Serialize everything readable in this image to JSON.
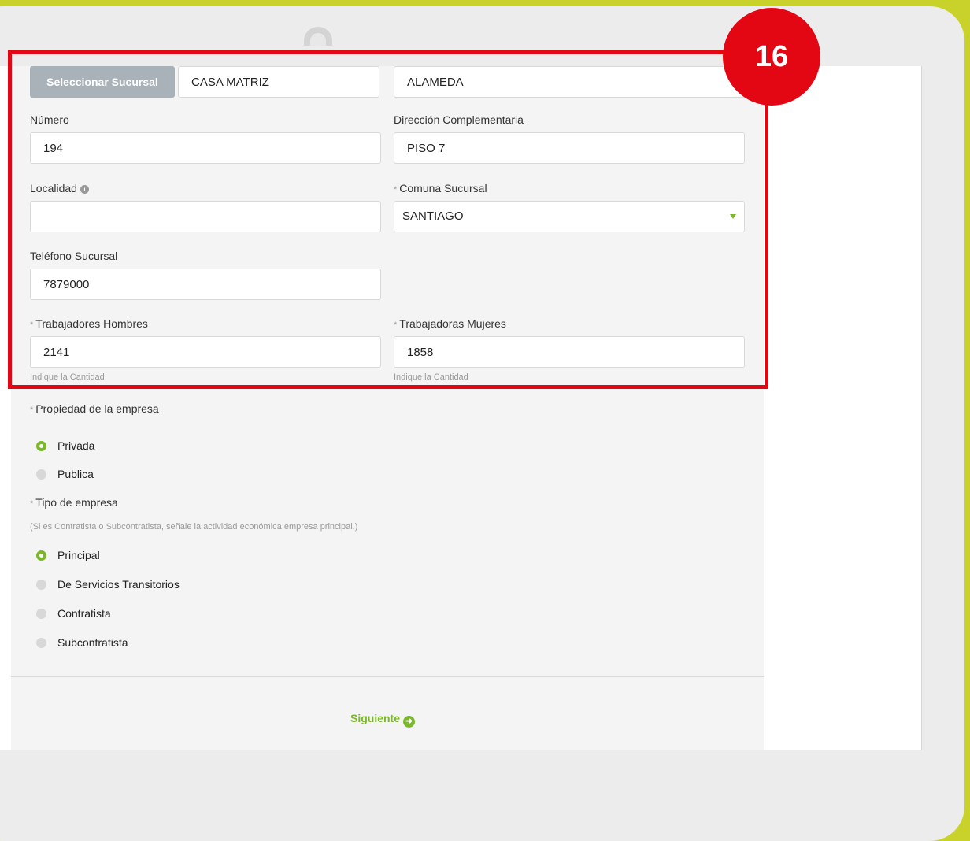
{
  "form": {
    "select_branch_button": "Seleccionar Sucursal",
    "branch_name": "CASA MATRIZ",
    "street": "ALAMEDA",
    "numero": {
      "label": "Número",
      "value": "194"
    },
    "direccion_complementaria": {
      "label": "Dirección Complementaria",
      "value": "PISO 7"
    },
    "localidad": {
      "label": "Localidad",
      "value": ""
    },
    "comuna": {
      "required_mark": "*",
      "label": "Comuna Sucursal",
      "value": "SANTIAGO"
    },
    "telefono": {
      "label": "Teléfono Sucursal",
      "value": "7879000"
    },
    "trabajadores_hombres": {
      "required_mark": "*",
      "label": "Trabajadores Hombres",
      "value": "2141",
      "hint": "Indique la Cantidad"
    },
    "trabajadoras_mujeres": {
      "required_mark": "*",
      "label": "Trabajadoras Mujeres",
      "value": "1858",
      "hint": "Indique la Cantidad"
    },
    "propiedad": {
      "required_mark": "*",
      "label": "Propiedad de la empresa",
      "options": [
        {
          "label": "Privada",
          "selected": true
        },
        {
          "label": "Publica",
          "selected": false
        }
      ]
    },
    "tipo": {
      "required_mark": "*",
      "label": "Tipo de empresa",
      "note": "(Si es Contratista o Subcontratista, señale la actividad económica empresa principal.)",
      "options": [
        {
          "label": "Principal",
          "selected": true
        },
        {
          "label": "De Servicios Transitorios",
          "selected": false
        },
        {
          "label": "Contratista",
          "selected": false
        },
        {
          "label": "Subcontratista",
          "selected": false
        }
      ]
    },
    "next_label": "Siguiente"
  },
  "annotation": {
    "step_number": "16",
    "highlight_color": "#e30613"
  },
  "colors": {
    "accent": "#7ab829",
    "top_bar": "#c9d22a",
    "button_gray": "#a9b2b9"
  },
  "icons": {
    "info": "info-circle-icon",
    "next": "arrow-right-circle-icon",
    "dropdown": "caret-down-icon"
  }
}
